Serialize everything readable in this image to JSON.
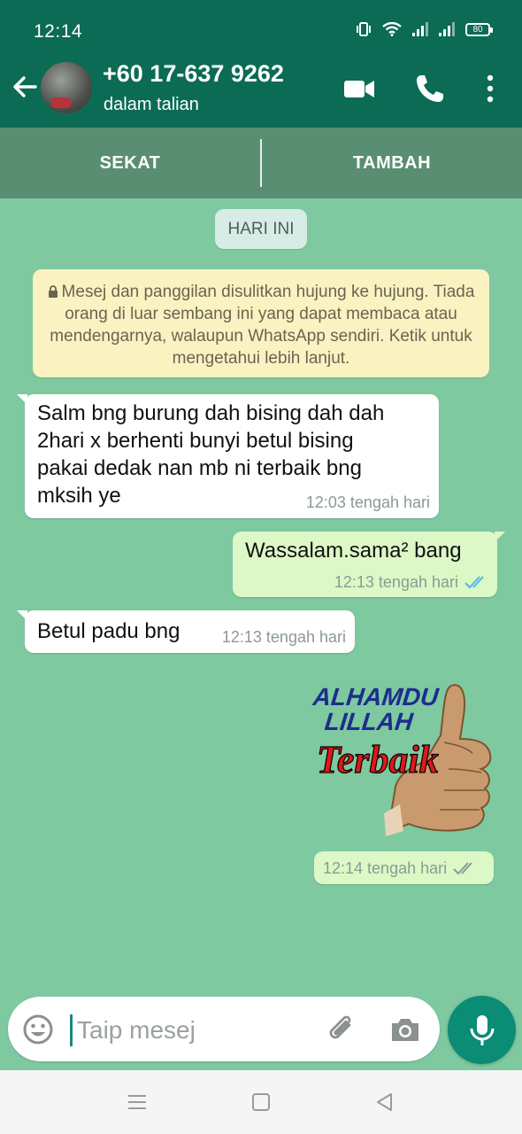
{
  "status_bar": {
    "time": "12:14",
    "battery": "80"
  },
  "header": {
    "contact_name": "+60 17-637 9262",
    "contact_status": "dalam talian"
  },
  "action_bar": {
    "block_label": "SEKAT",
    "add_label": "TAMBAH"
  },
  "date_chip": "HARI INI",
  "encryption_notice": "Mesej dan panggilan disulitkan hujung ke hujung. Tiada orang di luar sembang ini yang dapat membaca atau mendengarnya, walaupun WhatsApp sendiri. Ketik untuk mengetahui lebih lanjut.",
  "messages": [
    {
      "direction": "incoming",
      "text_lines": [
        "Salm bng burung dah bising dah dah",
        "2hari x berhenti bunyi betul bising",
        "pakai dedak nan mb ni terbaik bng",
        "mksih ye"
      ],
      "time": "12:03 tengah hari"
    },
    {
      "direction": "outgoing",
      "text": "Wassalam.sama² bang",
      "time": "12:13 tengah hari",
      "read": true
    },
    {
      "direction": "incoming",
      "text": "Betul padu bng",
      "time": "12:13 tengah hari"
    },
    {
      "direction": "outgoing",
      "type": "sticker",
      "sticker_text": [
        "ALHAMDU",
        "LILLAH",
        "Terbaik"
      ],
      "time": "12:14 tengah hari",
      "read": false
    }
  ],
  "composer": {
    "placeholder": "Taip mesej"
  },
  "colors": {
    "header": "#0b6b54",
    "chat_bg": "#7ec9a0",
    "outgoing": "#dcf8c6",
    "incoming": "#ffffff",
    "read_tick": "#4fb6ec",
    "mic": "#0a8c75"
  }
}
